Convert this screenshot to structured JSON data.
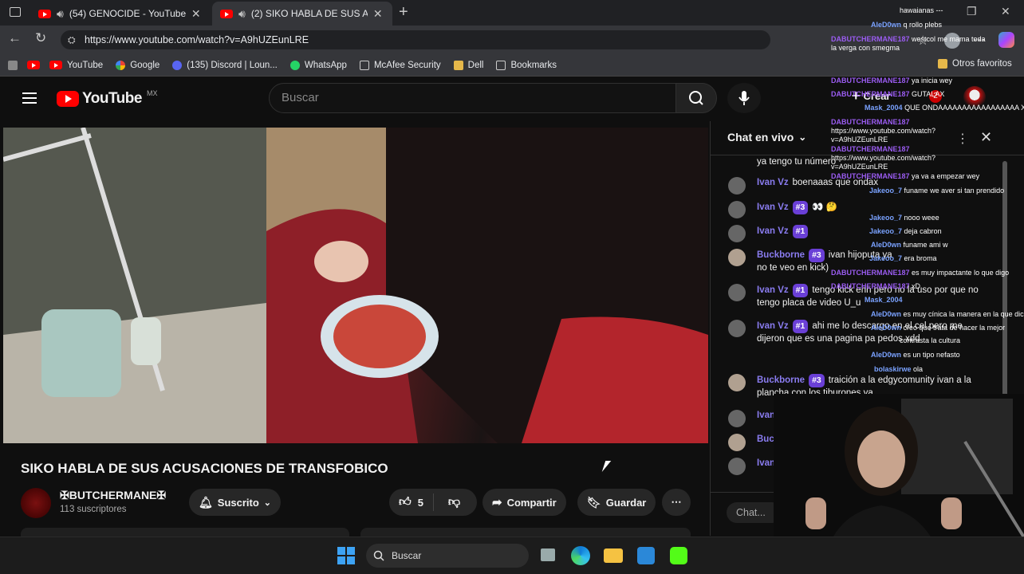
{
  "browser": {
    "tabs": [
      {
        "title": "(54) GENOCIDE - YouTube",
        "active": false
      },
      {
        "title": "(2) SIKO HABLA DE SUS ACU",
        "active": true
      }
    ],
    "url": "https://www.youtube.com/watch?v=A9hUZEunLRE",
    "bookmarks": [
      "YouTube",
      "Google",
      "(135) Discord | Loun...",
      "WhatsApp",
      "McAfee Security",
      "Dell",
      "Bookmarks"
    ],
    "other_favorites": "Otros favoritos"
  },
  "youtube": {
    "logo_text": "YouTube",
    "logo_region": "MX",
    "search_placeholder": "Buscar",
    "create_label": "Crear",
    "notification_count": "2"
  },
  "video": {
    "title": "SIKO HABLA DE SUS ACUSACIONES DE TRANSFOBICO",
    "channel": "✠BUTCHERMANE✠",
    "subscribers": "113 suscriptores",
    "subscribed_label": "Suscrito",
    "likes": "5",
    "share_label": "Compartir",
    "save_label": "Guardar"
  },
  "chat": {
    "header": "Chat en vivo",
    "input_placeholder": "Chat...",
    "messages": [
      {
        "text": "ya tengo tu número"
      },
      {
        "name": "Ivan Vz",
        "text": "boenaaas que ondax"
      },
      {
        "name": "Ivan Vz",
        "badge": "#3",
        "text": "👀 🤔"
      },
      {
        "name": "Ivan Vz",
        "badge": "#1",
        "text": ""
      },
      {
        "name": "Buckborne",
        "badge": "#3",
        "text": "ivan hijoputa ya no te veo en kick)"
      },
      {
        "name": "Ivan Vz",
        "badge": "#1",
        "text": "tengo kick ehh pero no la uso por que no tengo placa de video U_u"
      },
      {
        "name": "Ivan Vz",
        "badge": "#1",
        "text": "ahi me lo descargo en el cel pero me dijeron que es una pagina pa pedos xdd"
      },
      {
        "name": "Buckborne",
        "badge": "#3",
        "text": "traición a la edgycomunity ivan a la plancha con los tiburones ya"
      },
      {
        "name": "Ivan",
        "text": ""
      },
      {
        "name": "Buc",
        "text": ""
      },
      {
        "name": "Ivan",
        "text": "des"
      }
    ]
  },
  "overlay_chat": [
    {
      "name": "",
      "text": "hawaianas ---"
    },
    {
      "name": "AleD0wn",
      "text": "q rollo plebs"
    },
    {
      "name": "DABUTCHERMANE187",
      "text": "westcol me mama toda la verga con smegma"
    },
    {
      "name": "DABUTCHERMANE187",
      "text": "ya inicia wey"
    },
    {
      "name": "DABUTCHERMANE187",
      "text": "GUTALAX"
    },
    {
      "name": "Mask_2004",
      "text": "QUE ONDAAAAAAAAAAAAAAAAA X"
    },
    {
      "name": "DABUTCHERMANE187",
      "text": "https://www.youtube.com/watch?v=A9hUZEunLRE"
    },
    {
      "name": "DABUTCHERMANE187",
      "text": "https://www.youtube.com/watch?v=A9hUZEunLRE"
    },
    {
      "name": "DABUTCHERMANE187",
      "text": "ya va a empezar wey"
    },
    {
      "name": "Jakeoo_7",
      "text": "funame we aver si tan prendido"
    },
    {
      "name": "Jakeoo_7",
      "text": "nooo weee"
    },
    {
      "name": "Jakeoo_7",
      "text": "deja cabron"
    },
    {
      "name": "AleD0wn",
      "text": "funame ami w"
    },
    {
      "name": "Jakeoo_7",
      "text": "era broma"
    },
    {
      "name": "DABUTCHERMANE187",
      "text": "es muy impactante lo que digo"
    },
    {
      "name": "DABUTCHERMANE187",
      "text": "xD"
    },
    {
      "name": "Mask_2004",
      "text": ""
    },
    {
      "name": "AleD0wn",
      "text": "es muy cínica la manera en la que dice"
    },
    {
      "name": "AleD0wn",
      "text": "creo que trata de hacer la mejor"
    },
    {
      "name": "",
      "text": "contrasta la cultura"
    },
    {
      "name": "AleD0wn",
      "text": "es un tipo nefasto"
    },
    {
      "name": "bolaskirwe",
      "text": "ola"
    }
  ],
  "taskbar": {
    "search_placeholder": "Buscar"
  },
  "colors": {
    "youtube_red": "#ff0000",
    "chat_name": "#8a7cf0",
    "badge": "#6a3fd6",
    "overlay_name": "#9b5cf2"
  }
}
